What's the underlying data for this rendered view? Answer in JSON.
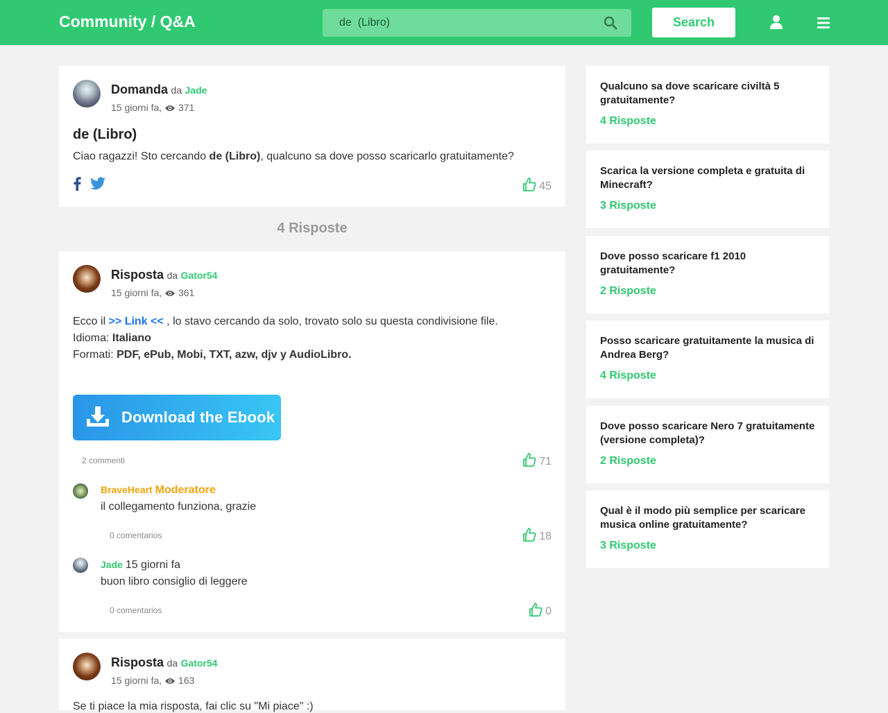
{
  "header": {
    "brand": "Community / Q&A",
    "search_value": "de  (Libro)",
    "search_button": "Search"
  },
  "question": {
    "type": "Domanda",
    "by": "da",
    "author": "Jade",
    "meta_time": "15 giorni fa,",
    "views": "371",
    "title": "de (Libro)",
    "body_prefix": "Ciao ragazzi! Sto cercando ",
    "body_bold": "de (Libro)",
    "body_suffix": ", qualcuno sa dove posso scaricarlo gratuitamente?",
    "likes": "45"
  },
  "answers_count": "4 Risposte",
  "answer1": {
    "type": "Risposta",
    "by": "da",
    "author": "Gator54",
    "meta_time": "15 giorni fa,",
    "views": "361",
    "line1_a": "Ecco il ",
    "link": ">> Link <<",
    "line1_b": " , lo stavo cercando da solo, trovato solo su questa condivisione file.",
    "lang_label": "Idioma: ",
    "lang_value": "Italiano",
    "formats_label": "Formati: ",
    "formats_value": "PDF, ePub, Mobi, TXT, azw, djv y AudioLibro.",
    "download_label": "Download the Ebook",
    "comments_count": "2 commenti",
    "likes": "71",
    "comments": [
      {
        "author": "BraveHeart",
        "role": "Moderatore",
        "time": "",
        "text": "il collegamento funziona, grazie",
        "replies": "0 comentarios",
        "likes": "18"
      },
      {
        "author": "Jade",
        "role": "",
        "time": "15 giorni fa",
        "text": "buon libro consiglio di leggere",
        "replies": "0 comentarios",
        "likes": "0"
      }
    ]
  },
  "answer2": {
    "type": "Risposta",
    "by": "da",
    "author": "Gator54",
    "meta_time": "15 giorni fa,",
    "views": "163",
    "body": "Se ti piace la mia risposta, fai clic su \"Mi piace\" :)"
  },
  "sidebar": [
    {
      "question": "Qualcuno sa dove scaricare civiltà 5 gratuitamente?",
      "answers": "4 Risposte"
    },
    {
      "question": "Scarica la versione completa e gratuita di Minecraft?",
      "answers": "3 Risposte"
    },
    {
      "question": "Dove posso scaricare f1 2010 gratuitamente?",
      "answers": "2 Risposte"
    },
    {
      "question": "Posso scaricare gratuitamente la musica di Andrea Berg?",
      "answers": "4 Risposte"
    },
    {
      "question": "Dove posso scaricare Nero 7 gratuitamente (versione completa)?",
      "answers": "2 Risposte"
    },
    {
      "question": "Qual è il modo più semplice per scaricare musica online gratuitamente?",
      "answers": "3 Risposte"
    }
  ],
  "colors": {
    "brand": "#30c971",
    "link": "#1a73e8",
    "moderator": "#f0a30a"
  }
}
